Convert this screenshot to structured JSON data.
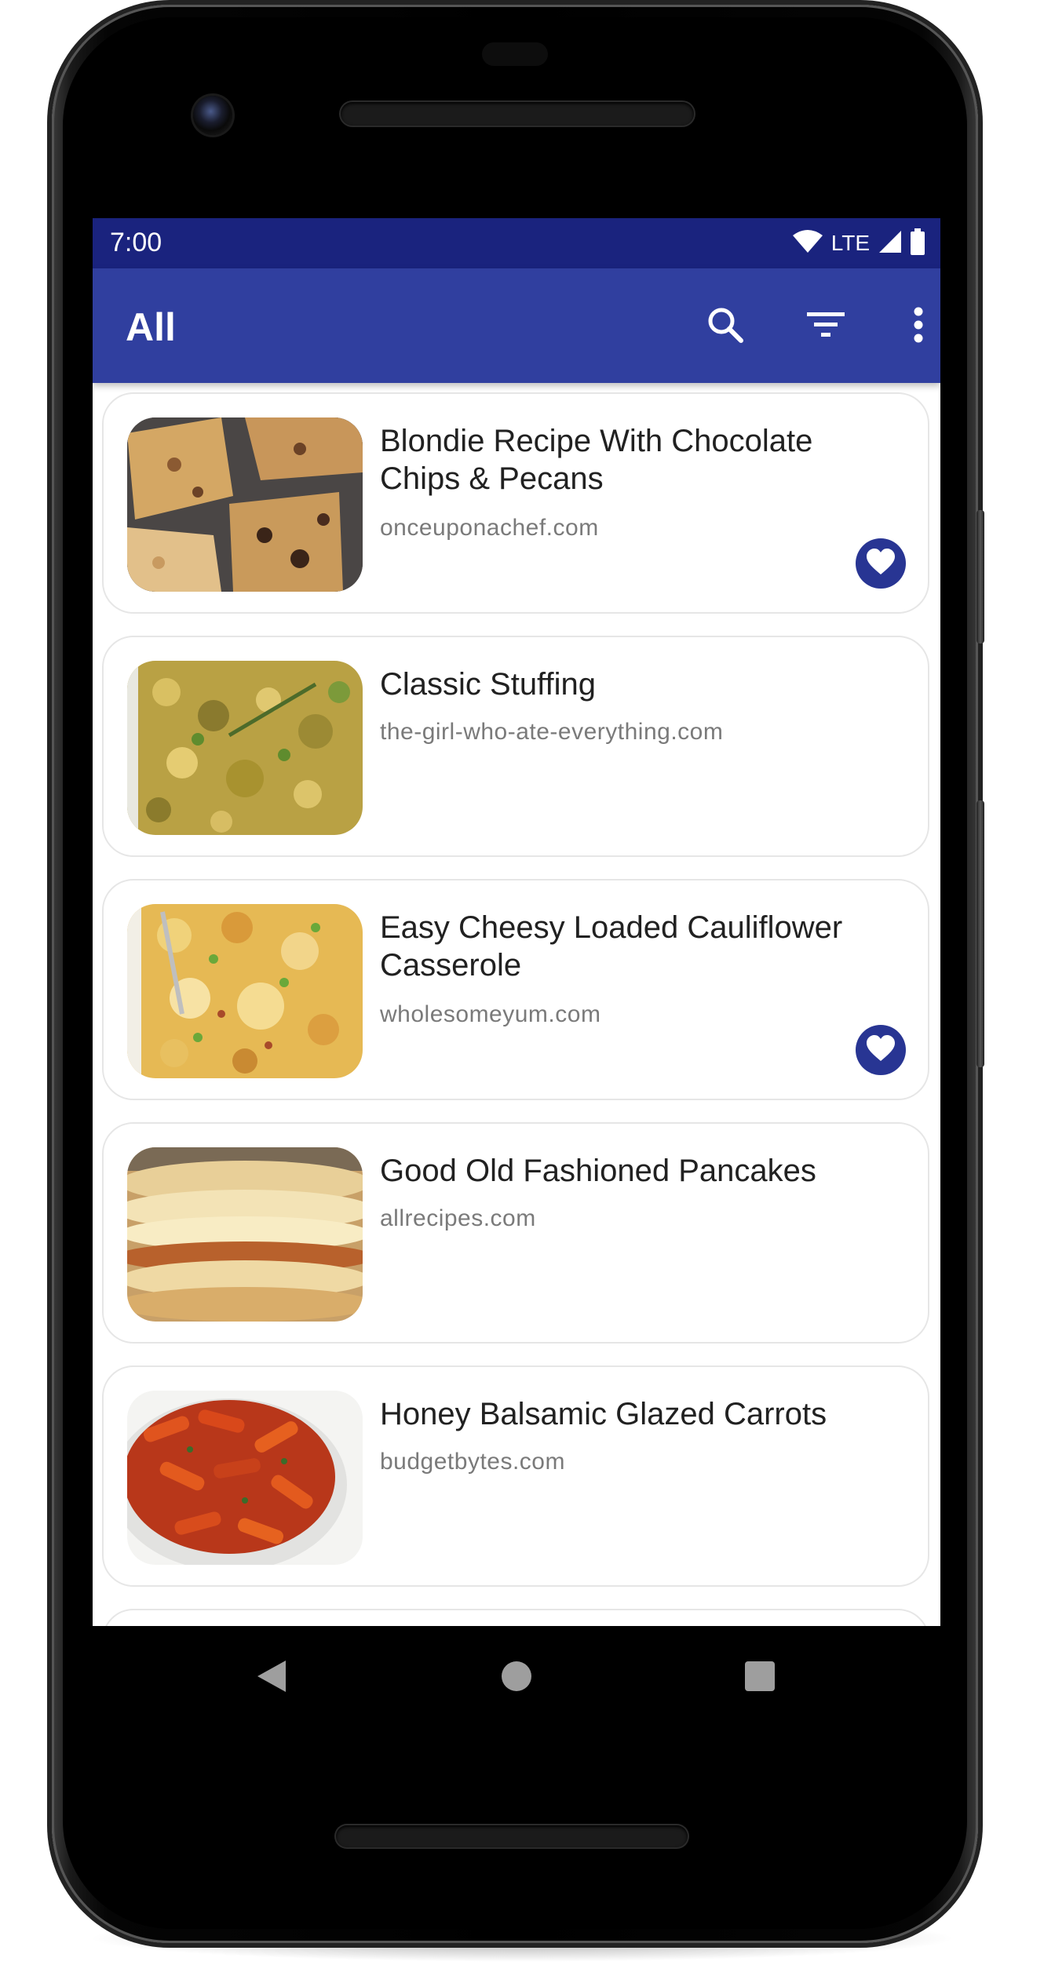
{
  "status_bar": {
    "time": "7:00",
    "network": "LTE"
  },
  "app_bar": {
    "title": "All",
    "actions": [
      {
        "icon": "search-icon"
      },
      {
        "icon": "filter-icon"
      },
      {
        "icon": "more-vert-icon"
      }
    ]
  },
  "recipes": [
    {
      "title": "Blondie Recipe With Chocolate Chips & Pecans",
      "source": "onceuponachef.com",
      "favorite": true
    },
    {
      "title": "Classic Stuffing",
      "source": "the-girl-who-ate-everything.com",
      "favorite": false
    },
    {
      "title": "Easy Cheesy Loaded Cauliflower Casserole",
      "source": "wholesomeyum.com",
      "favorite": true
    },
    {
      "title": "Good Old Fashioned Pancakes",
      "source": "allrecipes.com",
      "favorite": false
    },
    {
      "title": "Honey Balsamic Glazed Carrots",
      "source": "budgetbytes.com",
      "favorite": false
    }
  ],
  "nav_bar": {
    "buttons": [
      "back-icon",
      "home-icon",
      "recents-icon"
    ]
  },
  "colors": {
    "status_bar": "#1a237e",
    "app_bar": "#303f9f",
    "favorite": "#283593",
    "title_text": "#212121",
    "source_text": "#7a7a7a"
  }
}
